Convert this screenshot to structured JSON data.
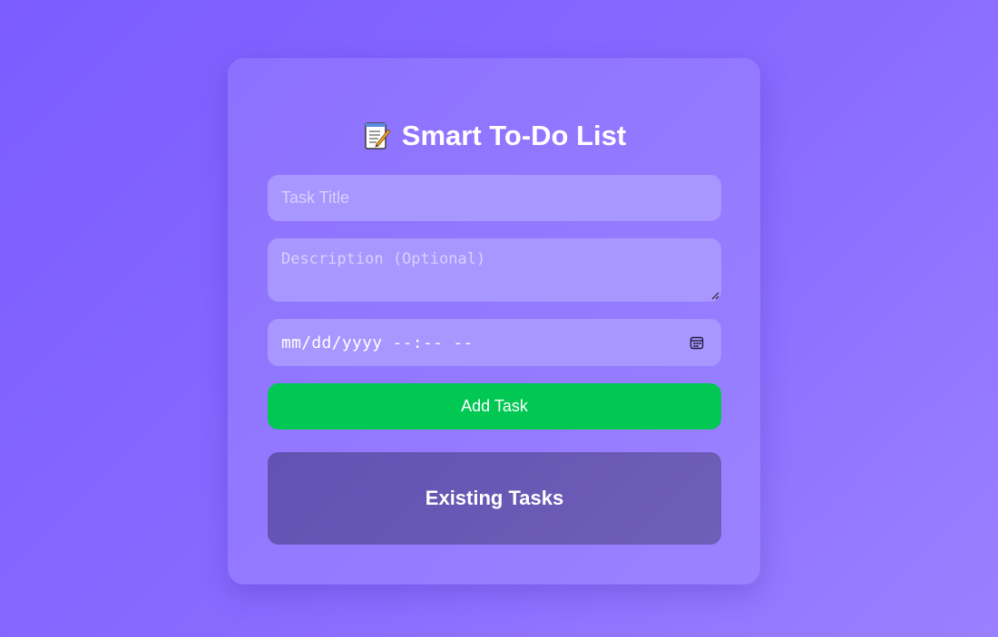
{
  "app": {
    "title": "Smart To-Do List",
    "title_icon": "memo-icon"
  },
  "form": {
    "title_placeholder": "Task Title",
    "description_placeholder": "Description (Optional)",
    "datetime_placeholder": "mm/dd/yyyy --:-- --",
    "calendar_icon": "calendar-icon",
    "add_button_label": "Add Task"
  },
  "tasks": {
    "heading": "Existing Tasks"
  },
  "colors": {
    "background": "#7b5cff",
    "card": "#9278ff",
    "input": "#a897ff",
    "button": "#00c853",
    "panel": "#6656b5"
  }
}
